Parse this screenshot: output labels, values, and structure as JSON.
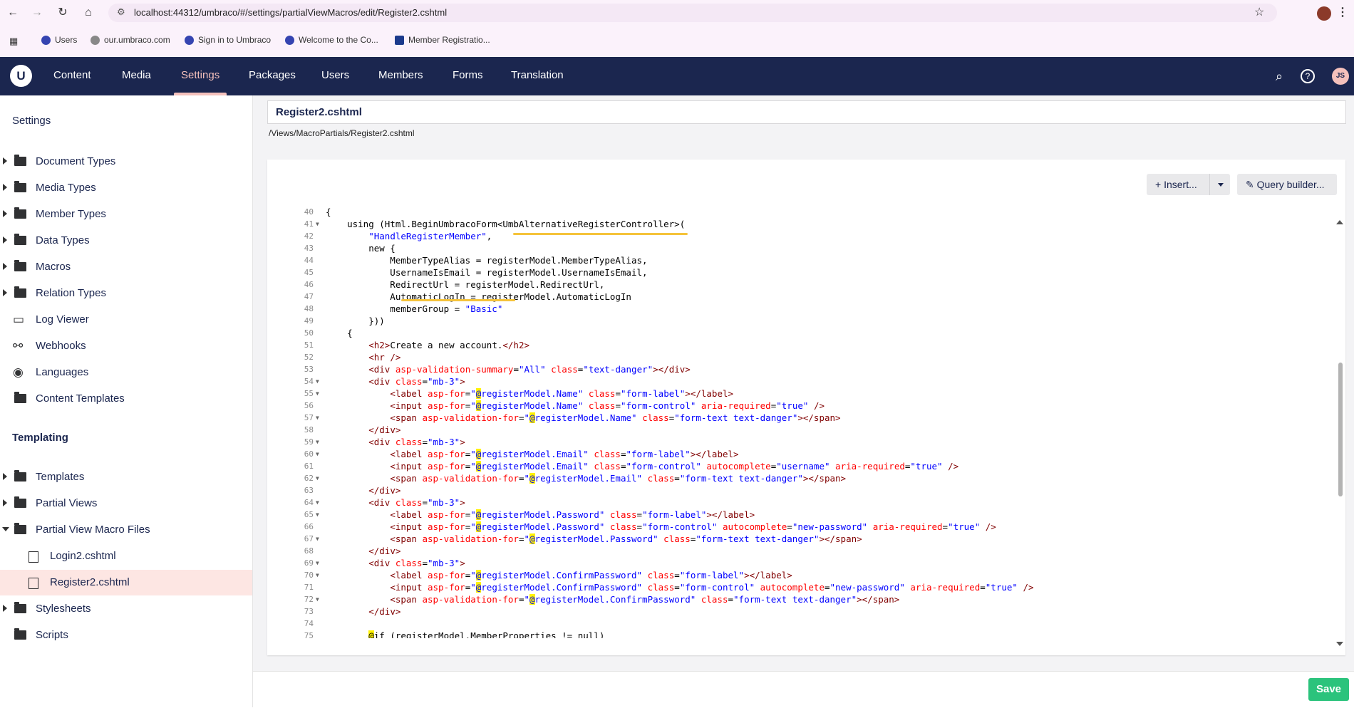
{
  "browser": {
    "url": "localhost:44312/umbraco/#/settings/partialViewMacros/edit/Register2.cshtml",
    "bookmarks": [
      "Users",
      "our.umbraco.com",
      "Sign in to Umbraco",
      "Welcome to the Co...",
      "Member Registratio..."
    ]
  },
  "header": {
    "nav": [
      "Content",
      "Media",
      "Settings",
      "Packages",
      "Users",
      "Members",
      "Forms",
      "Translation"
    ],
    "active": "Settings",
    "avatar_initials": "JS"
  },
  "sidebar": {
    "settings_title": "Settings",
    "settings_items": [
      "Document Types",
      "Media Types",
      "Member Types",
      "Data Types",
      "Macros",
      "Relation Types",
      "Log Viewer",
      "Webhooks",
      "Languages",
      "Content Templates"
    ],
    "templating_title": "Templating",
    "templating_items": [
      "Templates",
      "Partial Views",
      "Partial View Macro Files",
      "Login2.cshtml",
      "Register2.cshtml",
      "Stylesheets",
      "Scripts"
    ]
  },
  "editor": {
    "file_name": "Register2.cshtml",
    "file_path": "/Views/MacroPartials/Register2.cshtml",
    "insert_label": "Insert...",
    "query_builder_label": "Query builder...",
    "save_label": "Save",
    "line_numbers": [
      "40",
      "41",
      "42",
      "43",
      "44",
      "45",
      "46",
      "47",
      "48",
      "49",
      "50",
      "51",
      "52",
      "53",
      "54",
      "55",
      "56",
      "57",
      "58",
      "59",
      "60",
      "61",
      "62",
      "63",
      "64",
      "65",
      "66",
      "67",
      "68",
      "69",
      "70",
      "71",
      "72",
      "73",
      "74",
      "75"
    ]
  }
}
